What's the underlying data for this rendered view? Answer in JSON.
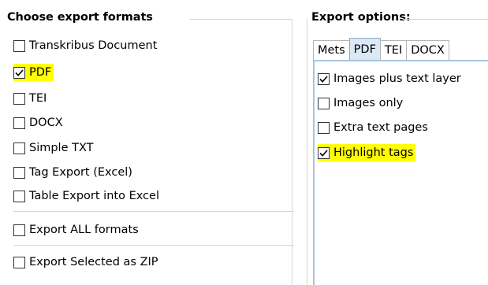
{
  "formats": {
    "title": "Choose export formats",
    "items": [
      {
        "label": "Transkribus Document",
        "checked": false,
        "highlighted": false
      },
      {
        "label": "PDF",
        "checked": true,
        "highlighted": true
      },
      {
        "label": "TEI",
        "checked": false,
        "highlighted": false
      },
      {
        "label": "DOCX",
        "checked": false,
        "highlighted": false
      },
      {
        "label": "Simple TXT",
        "checked": false,
        "highlighted": false
      },
      {
        "label": "Tag Export (Excel)",
        "checked": false,
        "highlighted": false
      },
      {
        "label": "Table Export into Excel",
        "checked": false,
        "highlighted": false
      }
    ],
    "export_all": {
      "label": "Export ALL formats",
      "checked": false
    },
    "export_zip": {
      "label": "Export Selected as ZIP",
      "checked": false
    }
  },
  "options": {
    "title": "Export options:",
    "tabs": [
      {
        "label": "Mets",
        "active": false
      },
      {
        "label": "PDF",
        "active": true
      },
      {
        "label": "TEI",
        "active": false
      },
      {
        "label": "DOCX",
        "active": false
      }
    ],
    "pdf_items": [
      {
        "label": "Images plus text layer",
        "checked": true,
        "highlighted": false
      },
      {
        "label": "Images only",
        "checked": false,
        "highlighted": false
      },
      {
        "label": "Extra text pages",
        "checked": false,
        "highlighted": false
      },
      {
        "label": "Highlight tags",
        "checked": true,
        "highlighted": true
      }
    ]
  },
  "colors": {
    "highlight": "#ffff00",
    "active_tab": "#dbe8f5",
    "tab_panel_border": "#a9c4e0"
  }
}
